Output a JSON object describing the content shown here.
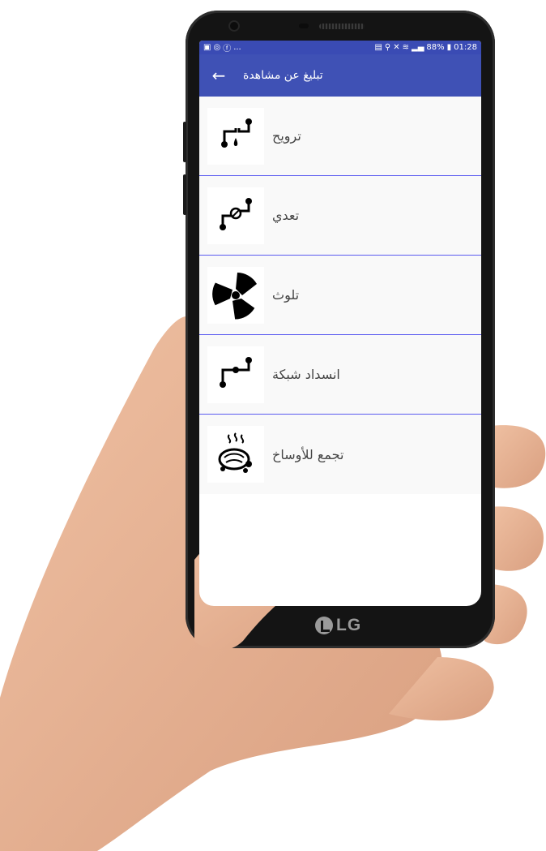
{
  "statusbar": {
    "left_icons": [
      "gallery-icon",
      "location-icon",
      "facebook-icon"
    ],
    "left_more": "...",
    "battery": "88%",
    "time": "01:28"
  },
  "appbar": {
    "back_icon": "arrow-back-icon",
    "title": "تبليغ عن مشاهدة"
  },
  "items": [
    {
      "label": "ترويح",
      "icon": "pipe-leak-icon"
    },
    {
      "label": "تعدي",
      "icon": "pipe-valve-icon"
    },
    {
      "label": "تلوث",
      "icon": "radiation-icon"
    },
    {
      "label": "انسداد شبكة",
      "icon": "pipe-block-icon"
    },
    {
      "label": "تجمع للأوساخ",
      "icon": "dirt-pile-icon"
    }
  ],
  "device": {
    "brand": "LG"
  },
  "colors": {
    "appbar": "#3f51b5",
    "statusbar": "#3a4bb4",
    "divider": "#5b5bf0"
  }
}
